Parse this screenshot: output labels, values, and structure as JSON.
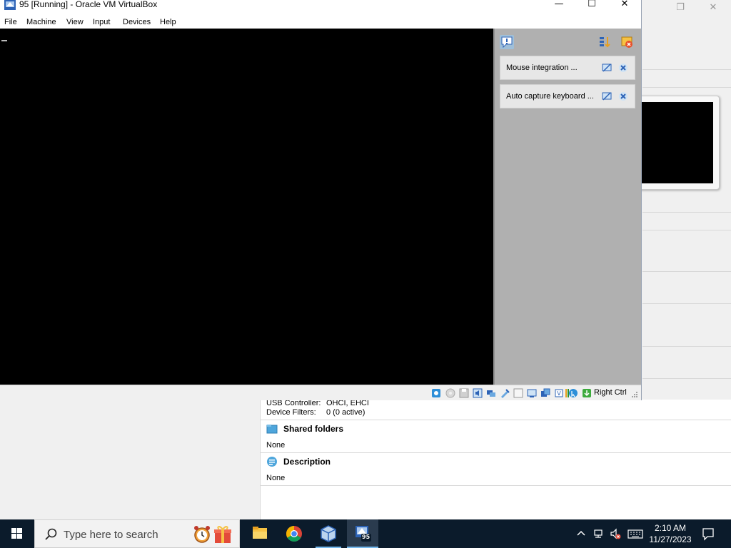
{
  "vm_window": {
    "title": "95 [Running] - Oracle VM VirtualBox",
    "caption": {
      "minimize": "—",
      "maximize": "☐",
      "close": "✕"
    },
    "menu": [
      "File",
      "Machine",
      "View",
      "Input",
      "Devices",
      "Help"
    ],
    "notifications": [
      {
        "text": "Mouse integration ..."
      },
      {
        "text": "Auto capture keyboard ..."
      }
    ],
    "statusbar": {
      "host_key": "Right Ctrl"
    }
  },
  "manager": {
    "caption": {
      "restore": "❐",
      "close": "✕"
    },
    "details": {
      "usb": [
        {
          "key": "USB Controller:",
          "value": "OHCI, EHCI"
        },
        {
          "key": "Device Filters:",
          "value": "0 (0 active)"
        }
      ],
      "shared_folders": {
        "title": "Shared folders",
        "value": "None"
      },
      "description": {
        "title": "Description",
        "value": "None"
      }
    }
  },
  "taskbar": {
    "search_placeholder": "Type here to search",
    "clock": {
      "time": "2:10 AM",
      "date": "11/27/2023"
    },
    "apps": [
      "alarm-clock",
      "gift",
      "file-explorer",
      "chrome",
      "virtualbox-manager",
      "virtualbox-vm-95"
    ],
    "active_app_badge": "95"
  },
  "colors": {
    "taskbar": "#0b1b2b",
    "notification_pane": "#b0b0b0",
    "accent": "#76b9ed"
  }
}
